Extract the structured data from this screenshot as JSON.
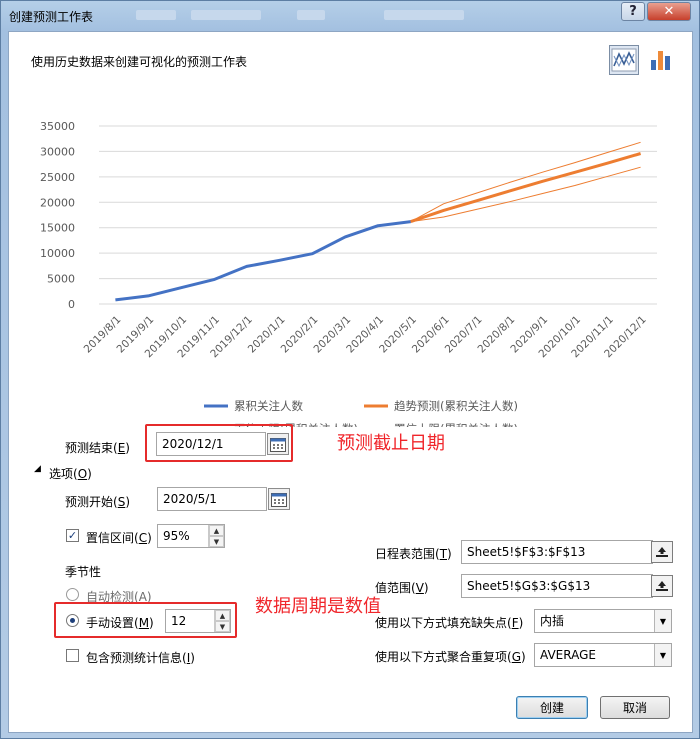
{
  "window": {
    "title": "创建预测工作表",
    "help_label": "?",
    "close_label": "✕"
  },
  "header": {
    "description": "使用历史数据来创建可视化的预测工作表"
  },
  "icons": {
    "line_chart": "line-chart-icon",
    "bar_chart": "bar-chart-icon",
    "calendar": "calendar-icon",
    "range_collapse": "range-select-icon",
    "dropdown": "chevron-down-icon"
  },
  "chart_data": {
    "type": "line",
    "ylim": [
      0,
      35000
    ],
    "yticks": [
      0,
      5000,
      10000,
      15000,
      20000,
      25000,
      30000,
      35000
    ],
    "ytick_labels": [
      "0",
      "5000",
      "10000",
      "15000",
      "20000",
      "25000",
      "30000",
      "35000"
    ],
    "categories": [
      "2019/8/1",
      "2019/9/1",
      "2019/10/1",
      "2019/11/1",
      "2019/12/1",
      "2020/1/1",
      "2020/2/1",
      "2020/3/1",
      "2020/4/1",
      "2020/5/1",
      "2020/6/1",
      "2020/7/1",
      "2020/8/1",
      "2020/9/1",
      "2020/10/1",
      "2020/11/1",
      "2020/12/1"
    ],
    "series": [
      {
        "name": "累积关注人数",
        "color": "#4472c4",
        "x_index": [
          0,
          1,
          2,
          3,
          4,
          5,
          6,
          7,
          8,
          9
        ],
        "values": [
          800,
          1600,
          3200,
          4800,
          7400,
          8600,
          9900,
          13200,
          15400,
          16200
        ]
      },
      {
        "name": "趋势预测(累积关注人数)",
        "color": "#ed7d31",
        "x_index": [
          9,
          10,
          11,
          12,
          13,
          14,
          15,
          16
        ],
        "values": [
          16200,
          18400,
          20300,
          22200,
          24100,
          25900,
          27700,
          29600
        ]
      },
      {
        "name": "置信下限(累积关注人数)",
        "color": "#ed7d31",
        "x_index": [
          9,
          10,
          11,
          12,
          13,
          14,
          15,
          16
        ],
        "values": [
          16200,
          17100,
          18600,
          20100,
          21700,
          23300,
          25100,
          26900
        ]
      },
      {
        "name": "置信上限(累积关注人数)",
        "color": "#ed7d31",
        "x_index": [
          9,
          10,
          11,
          12,
          13,
          14,
          15,
          16
        ],
        "values": [
          16200,
          19700,
          21800,
          23900,
          25900,
          27800,
          29800,
          31800
        ]
      }
    ],
    "legend": "bottom",
    "grid": true
  },
  "form": {
    "forecast_end_label": "预测结束(",
    "forecast_end_key": "E",
    "forecast_end_value": "2020/12/1",
    "options_arrow": "◢",
    "options_label": "选项(",
    "options_key": "O",
    "forecast_start_label": "预测开始(",
    "forecast_start_key": "S",
    "forecast_start_value": "2020/5/1",
    "confidence_label": "置信区间(",
    "confidence_key": "C",
    "confidence_value": "95%",
    "seasonality_label": "季节性",
    "auto_detect_label": "自动检测(",
    "auto_detect_key": "A",
    "manual_label": "手动设置(",
    "manual_key": "M",
    "manual_value": "12",
    "include_stats_label": "包含预测统计信息(",
    "include_stats_key": "I",
    "timeline_label": "日程表范围(",
    "timeline_key": "T",
    "timeline_value": "Sheet5!$F$3:$F$13",
    "values_label": "值范围(",
    "values_key": "V",
    "values_value": "Sheet5!$G$3:$G$13",
    "fill_missing_label": "使用以下方式填充缺失点(",
    "fill_missing_key": "F",
    "fill_missing_value": "内插",
    "aggregate_label": "使用以下方式聚合重复项(",
    "aggregate_key": "G",
    "aggregate_value": "AVERAGE",
    "close_paren": ")",
    "checkmark": "✓",
    "spin_up": "▲",
    "spin_down": "▼",
    "combo_arrow": "▼"
  },
  "annotations": {
    "end_date_note": "预测截止日期",
    "period_note": "数据周期是数值"
  },
  "footer": {
    "create_label": "创建",
    "cancel_label": "取消"
  }
}
